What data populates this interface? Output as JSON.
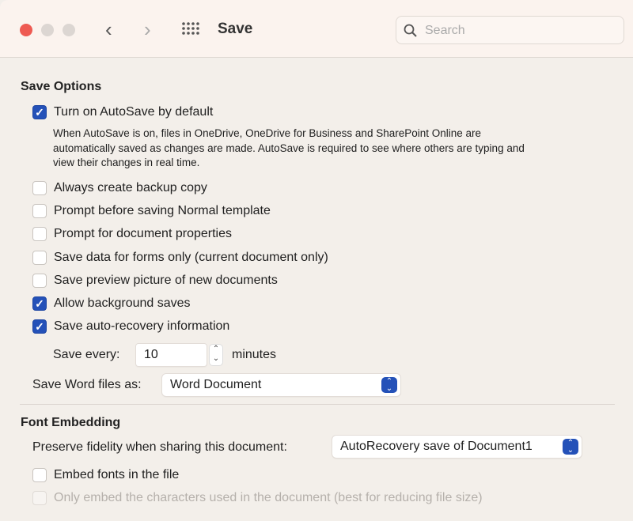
{
  "window": {
    "title": "Save",
    "search_placeholder": "Search"
  },
  "sections": {
    "save_options": "Save Options",
    "font_embedding": "Font Embedding"
  },
  "options": [
    {
      "label": "Turn on AutoSave by default",
      "checked": true
    },
    {
      "label": "Always create backup copy",
      "checked": false
    },
    {
      "label": "Prompt before saving Normal template",
      "checked": false
    },
    {
      "label": "Prompt for document properties",
      "checked": false
    },
    {
      "label": "Save data for forms only (current document only)",
      "checked": false
    },
    {
      "label": "Save preview picture of new documents",
      "checked": false
    },
    {
      "label": "Allow background saves",
      "checked": true
    },
    {
      "label": "Save auto-recovery information",
      "checked": true
    }
  ],
  "autosave_desc": [
    "When AutoSave is on, files in OneDrive, OneDrive for Business and SharePoint Online are",
    "automatically saved as changes are made. AutoSave is required to see where others are typing and",
    "view their changes in real time."
  ],
  "save_every": {
    "label": "Save every:",
    "value": "10",
    "unit": "minutes"
  },
  "save_as": {
    "label": "Save Word files as:",
    "value": "Word Document"
  },
  "fidelity": {
    "label": "Preserve fidelity when sharing this document:",
    "value": "AutoRecovery save of Document1"
  },
  "embed": [
    {
      "label": "Embed fonts in the file",
      "checked": false,
      "enabled": true
    },
    {
      "label": "Only embed the characters used in the document (best for reducing file size)",
      "checked": false,
      "enabled": false
    }
  ],
  "colors": {
    "accent": "#2451b8",
    "close": "#ee5a52"
  }
}
